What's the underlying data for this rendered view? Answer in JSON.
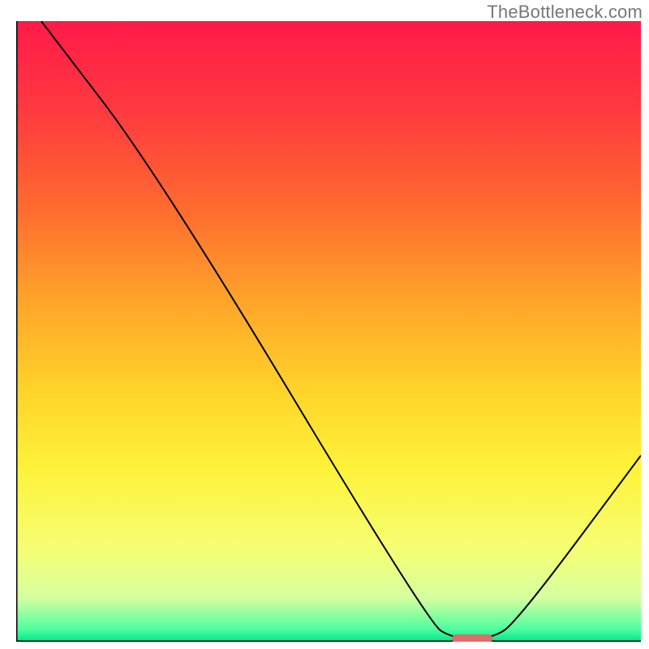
{
  "watermark": "TheBottleneck.com",
  "chart_data": {
    "type": "line",
    "title": "",
    "xlabel": "",
    "ylabel": "",
    "xlim": [
      0,
      100
    ],
    "ylim": [
      0,
      100
    ],
    "grid": false,
    "legend": false,
    "annotations": [],
    "background": {
      "type": "vertical-gradient",
      "stops": [
        {
          "pos": 0.0,
          "color": "#ff1a49"
        },
        {
          "pos": 0.15,
          "color": "#ff3b3f"
        },
        {
          "pos": 0.3,
          "color": "#ff6a2f"
        },
        {
          "pos": 0.45,
          "color": "#ffa42a"
        },
        {
          "pos": 0.6,
          "color": "#ffd52a"
        },
        {
          "pos": 0.72,
          "color": "#fff23a"
        },
        {
          "pos": 0.86,
          "color": "#f4ff78"
        },
        {
          "pos": 0.93,
          "color": "#d4ffa0"
        },
        {
          "pos": 0.98,
          "color": "#4dffa0"
        },
        {
          "pos": 1.0,
          "color": "#00e688"
        }
      ]
    },
    "series": [
      {
        "name": "curve",
        "color": "#000000",
        "width": 2,
        "points": [
          {
            "x": 4,
            "y": 100
          },
          {
            "x": 23,
            "y": 75
          },
          {
            "x": 66,
            "y": 3
          },
          {
            "x": 70,
            "y": 0.5
          },
          {
            "x": 76,
            "y": 0.5
          },
          {
            "x": 80,
            "y": 3
          },
          {
            "x": 100,
            "y": 30
          }
        ]
      }
    ],
    "marker": {
      "name": "highlight-pill",
      "color": "#e06b6b",
      "x": 73,
      "y": 0.5,
      "width": 6.5,
      "height": 1.4
    },
    "axes": {
      "left": {
        "visible": true,
        "color": "#000000",
        "width": 3
      },
      "bottom": {
        "visible": true,
        "color": "#000000",
        "width": 3
      },
      "right": {
        "visible": false
      },
      "top": {
        "visible": false
      }
    }
  }
}
